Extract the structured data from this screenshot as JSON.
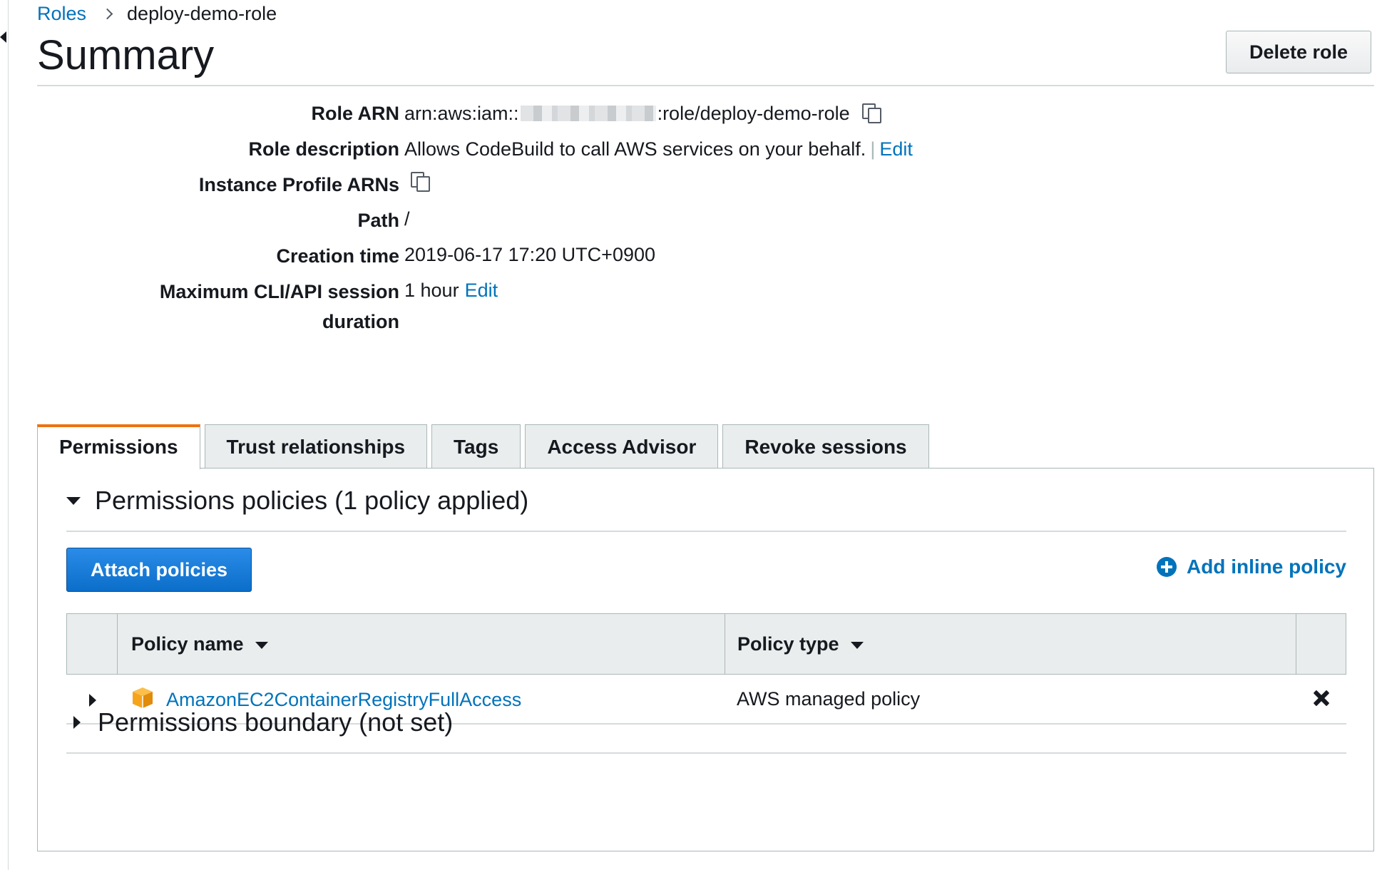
{
  "breadcrumb": {
    "parent": "Roles",
    "current": "deploy-demo-role"
  },
  "page": {
    "title": "Summary",
    "delete_button": "Delete role"
  },
  "summary": {
    "role_arn": {
      "label": "Role ARN",
      "prefix": "arn:aws:iam::",
      "suffix": ":role/deploy-demo-role"
    },
    "role_description": {
      "label": "Role description",
      "value": "Allows CodeBuild to call AWS services on your behalf.",
      "edit": "Edit"
    },
    "instance_profile_arns": {
      "label": "Instance Profile ARNs"
    },
    "path": {
      "label": "Path",
      "value": "/"
    },
    "creation_time": {
      "label": "Creation time",
      "value": "2019-06-17 17:20 UTC+0900"
    },
    "max_session": {
      "label_line1": "Maximum CLI/API session",
      "label_line2": "duration",
      "value": "1 hour",
      "edit": "Edit"
    }
  },
  "tabs": [
    {
      "label": "Permissions",
      "active": true
    },
    {
      "label": "Trust relationships",
      "active": false
    },
    {
      "label": "Tags",
      "active": false
    },
    {
      "label": "Access Advisor",
      "active": false
    },
    {
      "label": "Revoke sessions",
      "active": false
    }
  ],
  "permissions": {
    "policies_section_title": "Permissions policies (1 policy applied)",
    "attach_button": "Attach policies",
    "add_inline_label": "Add inline policy",
    "table": {
      "columns": [
        "Policy name",
        "Policy type"
      ],
      "rows": [
        {
          "name": "AmazonEC2ContainerRegistryFullAccess",
          "type": "AWS managed policy"
        }
      ]
    },
    "boundary_section_title": "Permissions boundary (not set)"
  },
  "colors": {
    "link": "#0073bb",
    "active_tab_accent": "#ec7211",
    "primary_button": "#0b6ec9",
    "managed_policy_icon": "#f7a41c"
  },
  "icons": {
    "copy": "copy-icon",
    "add": "plus-circle-icon",
    "remove": "close-icon",
    "policy": "cube-icon"
  }
}
